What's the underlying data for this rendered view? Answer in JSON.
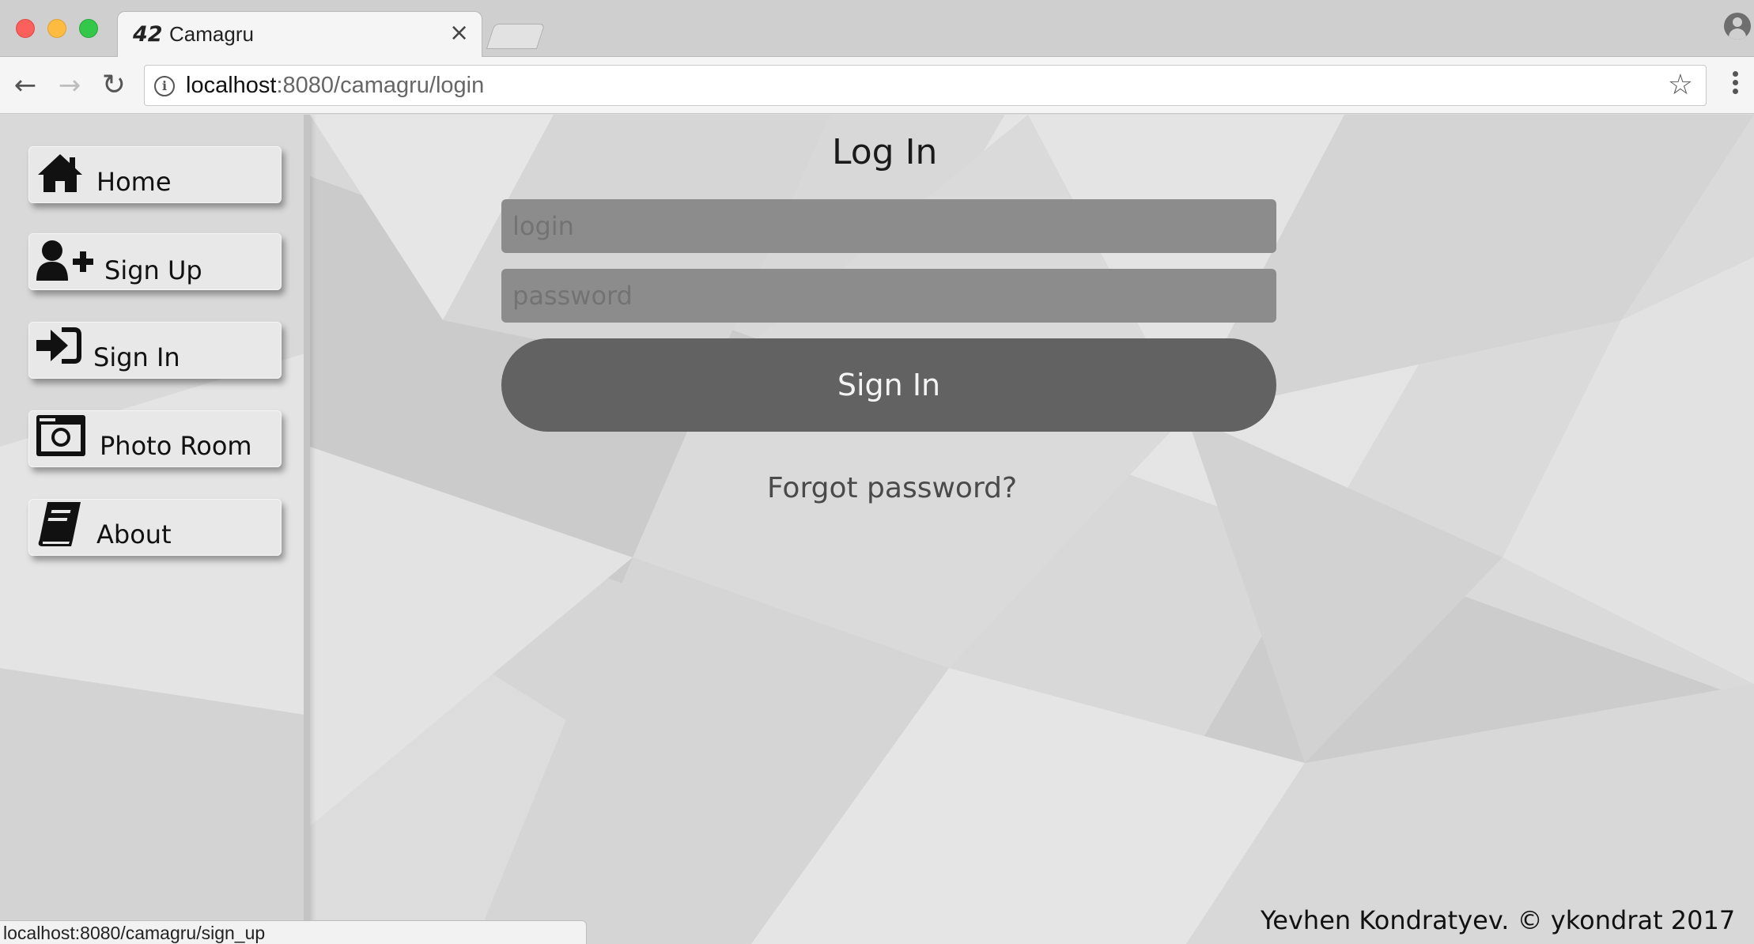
{
  "browser": {
    "tab": {
      "title": "Camagru",
      "favicon_text": "42",
      "close_label": "×"
    },
    "address": {
      "host": "localhost",
      "path": ":8080/camagru/login"
    },
    "status_url": "localhost:8080/camagru/sign_up"
  },
  "sidebar": {
    "items": [
      {
        "label": "Home",
        "icon": "home-icon"
      },
      {
        "label": "Sign Up",
        "icon": "user-plus-icon"
      },
      {
        "label": "Sign In",
        "icon": "sign-in-icon"
      },
      {
        "label": "Photo Room",
        "icon": "camera-icon"
      },
      {
        "label": "About",
        "icon": "book-icon"
      }
    ]
  },
  "login": {
    "title": "Log In",
    "login_placeholder": "login",
    "password_placeholder": "password",
    "submit_label": "Sign In",
    "forgot_label": "Forgot password?"
  },
  "footer": {
    "text": "Yevhen Kondratyev. © ykondrat 2017"
  },
  "colors": {
    "button": "#626262",
    "field": "#8c8c8c",
    "background": "#dedede"
  }
}
